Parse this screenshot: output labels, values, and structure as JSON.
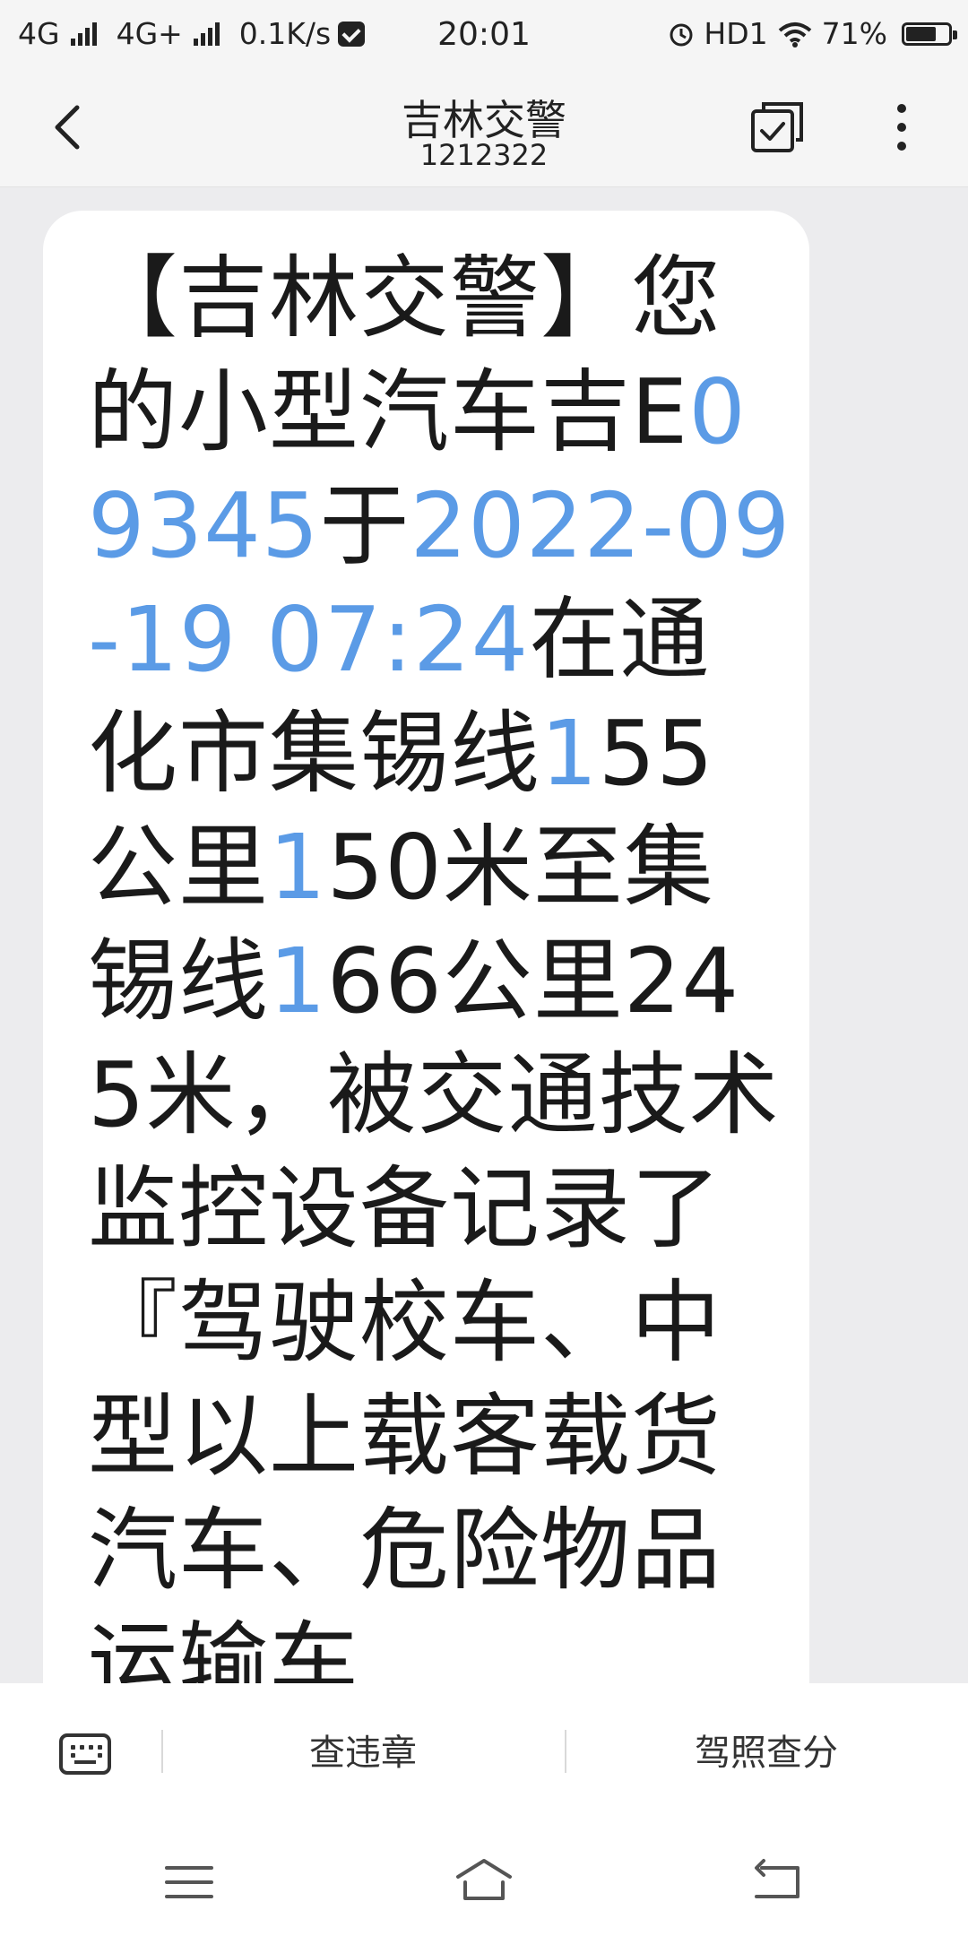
{
  "status_bar": {
    "network1": "4G",
    "network2": "4G+",
    "speed": "0.1K/s",
    "time": "20:01",
    "hd": "HD1",
    "battery": "71%",
    "battery_level": 0.71
  },
  "header": {
    "title": "吉林交警",
    "number": "1212322"
  },
  "message": {
    "segments": [
      {
        "text": "【吉林交警】您的小型汽车吉E",
        "link": false
      },
      {
        "text": "09345",
        "link": true
      },
      {
        "text": "于",
        "link": false
      },
      {
        "text": "2022-09-19 07:24",
        "link": true
      },
      {
        "text": "在通化市集锡线",
        "link": false
      },
      {
        "text": "1",
        "link": true
      },
      {
        "text": "55公里",
        "link": false
      },
      {
        "text": "1",
        "link": true
      },
      {
        "text": "50米至集锡线",
        "link": false
      },
      {
        "text": "1",
        "link": true
      },
      {
        "text": "66公里245米，被交通技术监控设备记录了『驾驶校车、中型以上载客载货汽车、危险物品运输车",
        "link": false
      }
    ]
  },
  "menu": {
    "item1": "查违章",
    "item2": "驾照查分"
  },
  "colors": {
    "link": "#5b9be6",
    "bubble": "#ffffff",
    "background": "#ececee"
  }
}
